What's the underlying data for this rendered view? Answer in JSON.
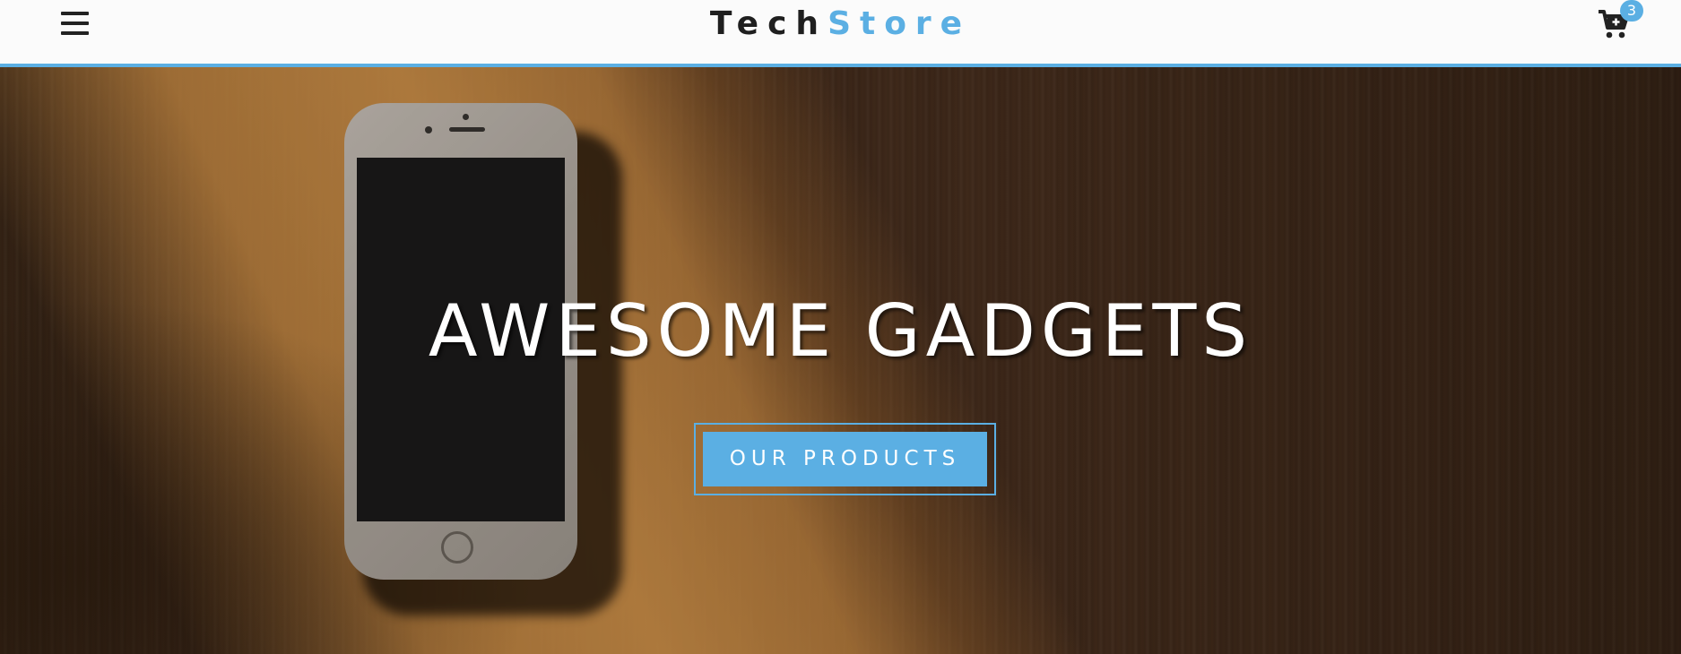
{
  "header": {
    "brand_primary": "Tech",
    "brand_accent": "Store",
    "menu_icon": "hamburger-menu-icon",
    "cart_icon": "shopping-cart-plus-icon",
    "cart_count": "3"
  },
  "hero": {
    "title": "AWESOME GADGETS",
    "cta_label": "OUR PRODUCTS",
    "background_image": "smartphone-on-wooden-desk"
  },
  "colors": {
    "accent": "#5bafe3",
    "header_background": "#fbfbfb",
    "brand_text": "#1f1f1f",
    "hero_text": "#ffffff"
  }
}
